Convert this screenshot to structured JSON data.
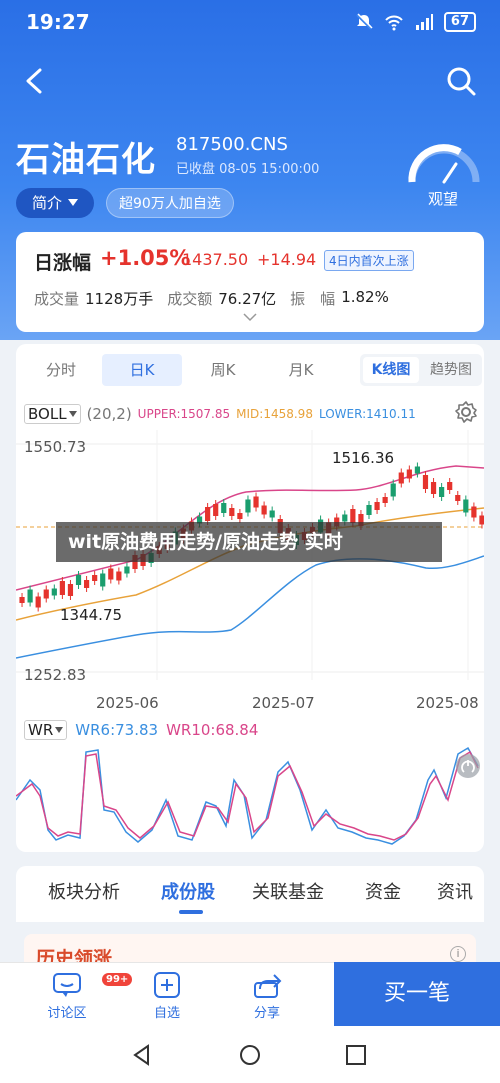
{
  "status_bar": {
    "time": "19:27",
    "battery": "67"
  },
  "stock": {
    "name": "石油石化",
    "code": "817500.CNS",
    "status": "已收盘 08-05 15:00:00",
    "intro_label": "简介",
    "watch_label": "超90万人加自选",
    "sentiment": "观望"
  },
  "quote": {
    "title": "日涨幅",
    "pct": "+1.05%",
    "price": "1437.50",
    "change": "+14.94",
    "badge": "4日内首次上涨",
    "volume_label": "成交量",
    "volume": "1128万手",
    "amount_label": "成交额",
    "amount": "76.27亿",
    "amplitude_label": "振　幅",
    "amplitude": "1.82%"
  },
  "chart_tabs": {
    "t1": "分时",
    "t2": "日K",
    "t3": "周K",
    "t4": "月K",
    "seg1": "K线图",
    "seg2": "趋势图"
  },
  "indicator": {
    "name": "BOLL",
    "params": "(20,2)",
    "upper": "UPPER:1507.85",
    "mid": "MID:1458.98",
    "lower": "LOWER:1410.11"
  },
  "kline": {
    "y_top": "1550.73",
    "y_bottom": "1252.83",
    "high_label": "1516.36",
    "low_label": "1344.75",
    "x_labels": [
      "2025-06",
      "2025-07",
      "2025-08"
    ]
  },
  "wr": {
    "name": "WR",
    "wr6": "WR6:73.83",
    "wr10": "WR10:68.84"
  },
  "banner": "wit原油费用走势/原油走势 实时",
  "section_tabs": [
    "板块分析",
    "成份股",
    "关联基金",
    "资金",
    "资讯"
  ],
  "history_title": "历史领涨",
  "bottom_bar": {
    "discuss": "讨论区",
    "discuss_badge": "99+",
    "watch": "自选",
    "share": "分享",
    "buy": "买一笔"
  },
  "colors": {
    "up": "#e5332d",
    "down": "#1a9e6e",
    "accent": "#2f6fdf",
    "upper": "#d9468a",
    "mid": "#e8a23a",
    "lower": "#3a8fe0"
  }
}
